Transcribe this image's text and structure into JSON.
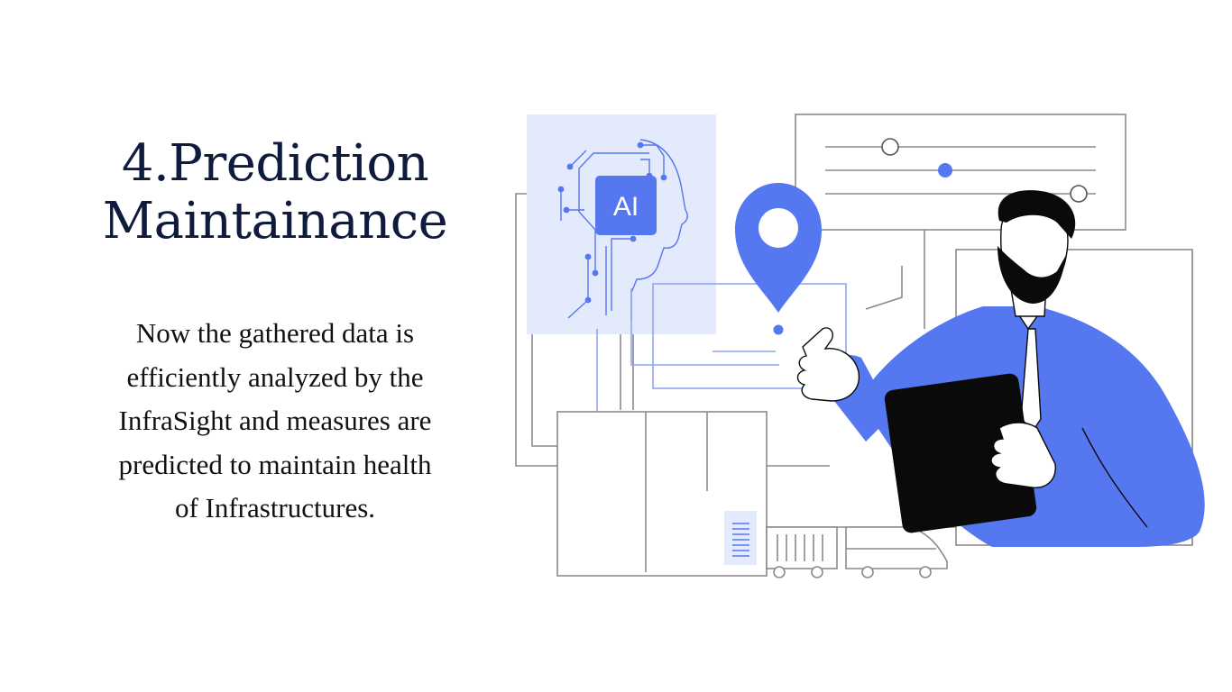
{
  "slide": {
    "title_lines": [
      "4.Prediction",
      "Maintainance"
    ],
    "body_lines": [
      "Now the gathered data is",
      "efficiently analyzed by the",
      "InfraSight and measures are",
      "predicted to maintain health",
      "of Infrastructures."
    ]
  },
  "illustration": {
    "ai_chip_label": "AI"
  },
  "colors": {
    "title": "#0f1b3d",
    "body": "#111111",
    "accent_blue": "#5577f0",
    "panel_blue": "#e2eafc",
    "line_gray": "#8a8a8a",
    "ink": "#0a0a0a"
  }
}
